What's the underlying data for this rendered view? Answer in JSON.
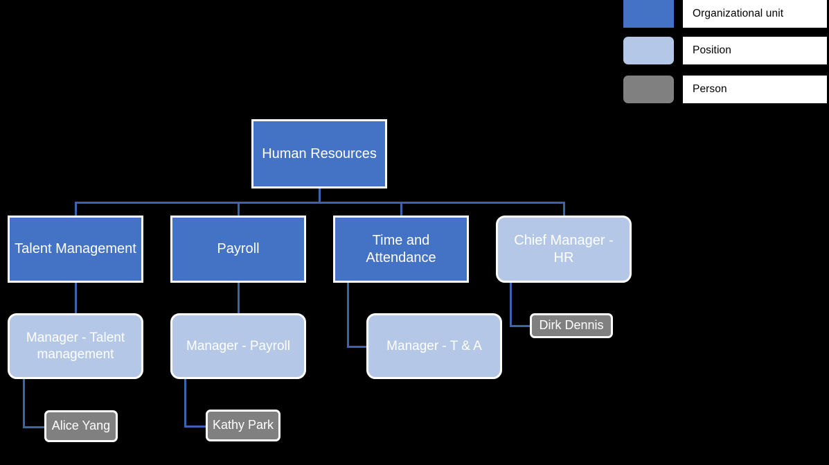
{
  "diagram": {
    "title_node": "Human  Resources",
    "background_color": "#000000",
    "connector_color": "#3B63AE",
    "border_color": "#ffffff"
  },
  "legend": {
    "items": [
      {
        "label": "Organizational unit",
        "color": "#4472C4",
        "shape": "rect"
      },
      {
        "label": "Position",
        "color": "#B4C7E7",
        "shape": "rounded-rect"
      },
      {
        "label": "Person",
        "color": "#808080",
        "shape": "rounded-rect"
      }
    ]
  },
  "nodes": {
    "root": {
      "label": "Human  Resources",
      "type": "Organizational unit",
      "color": "#4472C4"
    },
    "unit_talent": {
      "label": "Talent Management",
      "type": "Organizational unit",
      "color": "#4472C4"
    },
    "unit_payroll": {
      "label": "Payroll",
      "type": "Organizational unit",
      "color": "#4472C4"
    },
    "unit_time": {
      "label": "Time and\nAttendance",
      "type": "Organizational unit",
      "color": "#4472C4"
    },
    "pos_chief": {
      "label": "Chief Manager -\nHR",
      "type": "Position",
      "color": "#B4C7E7"
    },
    "pos_mgr_talent": {
      "label": "Manager - Talent\nmanagement",
      "type": "Position",
      "color": "#B4C7E7"
    },
    "pos_mgr_payroll": {
      "label": "Manager - Payroll",
      "type": "Position",
      "color": "#B4C7E7"
    },
    "pos_mgr_ta": {
      "label": "Manager - T & A",
      "type": "Position",
      "color": "#B4C7E7"
    },
    "person_dirk": {
      "label": "Dirk Dennis",
      "type": "Person",
      "color": "#808080"
    },
    "person_alice": {
      "label": "Alice Yang",
      "type": "Person",
      "color": "#808080"
    },
    "person_kathy": {
      "label": "Kathy Park",
      "type": "Person",
      "color": "#808080"
    }
  }
}
